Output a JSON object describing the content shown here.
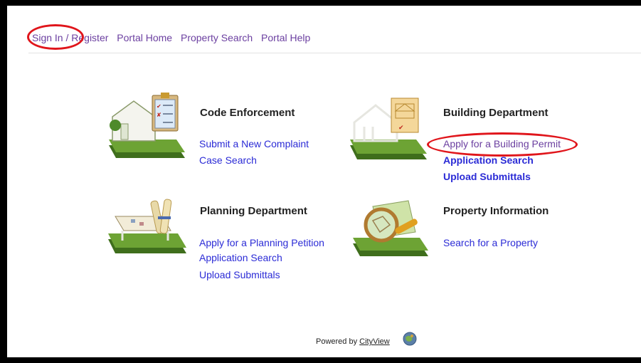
{
  "nav": {
    "sign_in": "Sign In / Register",
    "portal_home": "Portal Home",
    "property_search": "Property Search",
    "portal_help": "Portal Help"
  },
  "code_enforcement": {
    "title": "Code Enforcement",
    "links": [
      "Submit a New Complaint",
      "Case Search"
    ]
  },
  "building_department": {
    "title": "Building Department",
    "links": [
      "Apply for a Building Permit",
      "Application Search",
      "Upload Submittals"
    ]
  },
  "planning_department": {
    "title": "Planning Department",
    "links": [
      "Apply for a Planning Petition",
      "Application Search",
      "Upload Submittals"
    ]
  },
  "property_information": {
    "title": "Property Information",
    "links": [
      "Search for a Property"
    ]
  },
  "footer": {
    "powered_by": "Powered by",
    "brand": "CityView"
  },
  "colors": {
    "link": "#2b2bd6",
    "visited_link": "#6b3fa0",
    "annotation": "#e0151b",
    "lawn": "#5a8a2a"
  },
  "icons": {
    "code_enforcement": "house-checklist-icon",
    "building": "house-blueprint-icon",
    "planning": "map-scrolls-icon",
    "property": "magnifier-map-icon",
    "footer": "cityview-globe-icon"
  }
}
